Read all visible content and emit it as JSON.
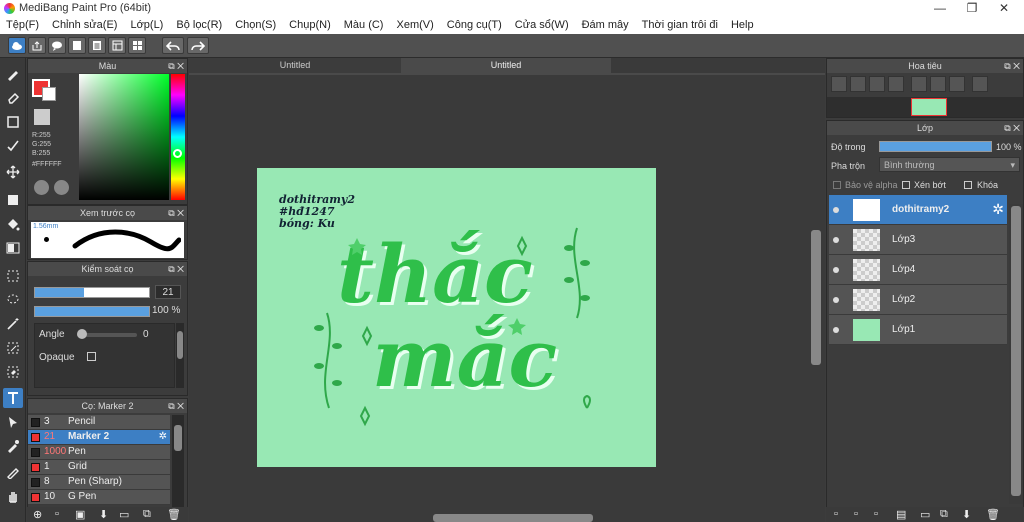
{
  "window": {
    "title": "MediBang Paint Pro (64bit)",
    "minimize": "—",
    "maximize": "❐",
    "close": "✕"
  },
  "menu": [
    "Tệp(F)",
    "Chỉnh sửa(E)",
    "Lớp(L)",
    "Bộ lọc(R)",
    "Chọn(S)",
    "Chụp(N)",
    "Màu (C)",
    "Xem(V)",
    "Công cụ(T)",
    "Cửa sổ(W)",
    "Đám mây",
    "Thời gian trôi đi",
    "Help"
  ],
  "color_panel": {
    "title": "Màu",
    "r": "R:255",
    "g": "G:255",
    "b": "B:255",
    "hex": "#FFFFFF"
  },
  "preview_panel": {
    "title": "Xem trước cọ",
    "size": "1.56mm"
  },
  "brush_control": {
    "title": "Kiểm soát cọ",
    "size_value": "21",
    "opacity_value": "100 %",
    "angle_label": "Angle",
    "angle_value": "0",
    "opaque_label": "Opaque"
  },
  "brush_list": {
    "title": "Cọ: Marker 2",
    "items": [
      {
        "size": "3",
        "name": "Pencil",
        "color": "dark"
      },
      {
        "size": "21",
        "name": "Marker 2",
        "color": "red"
      },
      {
        "size": "1000",
        "name": "Pen",
        "color": "dark"
      },
      {
        "size": "1",
        "name": "Grid",
        "color": "red"
      },
      {
        "size": "8",
        "name": "Pen (Sharp)",
        "color": "dark"
      },
      {
        "size": "10",
        "name": "G Pen",
        "color": "red"
      }
    ]
  },
  "tabs": [
    "Untitled",
    "Untitled"
  ],
  "canvas_text": {
    "line1": "dothitramy2",
    "line2": "#hđ1247",
    "line3": "bóng: Ku",
    "word1": "thắc",
    "word2": "mắc"
  },
  "navigator": {
    "title": "Hoa tiêu"
  },
  "layer_panel": {
    "title": "Lớp",
    "opacity_label": "Độ trong",
    "opacity_value": "100 %",
    "blend_label": "Pha trộn",
    "blend_value": "Bình thường",
    "protect_alpha": "Bảo vệ alpha",
    "clip": "Xén bớt",
    "lock": "Khóa",
    "layers": [
      "dothitramy2",
      "Lớp3",
      "Lớp4",
      "Lớp2",
      "Lớp1"
    ]
  },
  "colors": {
    "canvas": "#98e8b4",
    "accent": "#3d7fc4",
    "green_text": "#2fbf4a"
  }
}
